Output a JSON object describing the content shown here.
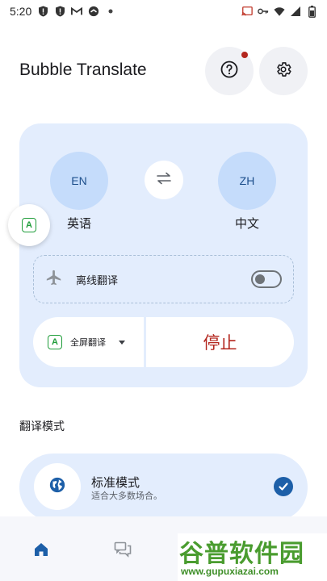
{
  "status_bar": {
    "time": "5:20",
    "left_icons": [
      "shield-alert-icon",
      "shield-alert-icon",
      "gmail-icon",
      "vpn-icon",
      "dot-icon"
    ],
    "right_icons": [
      "cast-icon",
      "key-icon",
      "wifi-icon",
      "signal-icon",
      "battery-icon"
    ]
  },
  "header": {
    "title": "Bubble Translate",
    "help_icon": "help-icon",
    "settings_icon": "gear-icon",
    "notification_color": "#b3261e"
  },
  "translator": {
    "source_code": "EN",
    "source_name": "英语",
    "target_code": "ZH",
    "target_name": "中文",
    "swap_icon": "swap-icon",
    "offline_label": "离线翻译",
    "offline_enabled": false,
    "mode_label": "全屏翻译",
    "stop_label": "停止"
  },
  "mode_section": {
    "title": "翻译模式",
    "options": [
      {
        "title": "标准模式",
        "description": "适合大多数场合。",
        "icon": "globe-icon",
        "selected": true
      }
    ]
  },
  "bottom_nav": {
    "items": [
      {
        "icon": "home-icon",
        "active": true
      },
      {
        "icon": "chat-icon",
        "active": false
      }
    ]
  },
  "watermark": {
    "main": "谷普软件园",
    "url": "www.gupuxiazai.com"
  },
  "colors": {
    "accent": "#1d5fa8",
    "card_bg": "#e3edfd",
    "lang_circle": "#c5dcfb",
    "stop_text": "#b3261e",
    "mode_icon": "#1f9d3a"
  }
}
